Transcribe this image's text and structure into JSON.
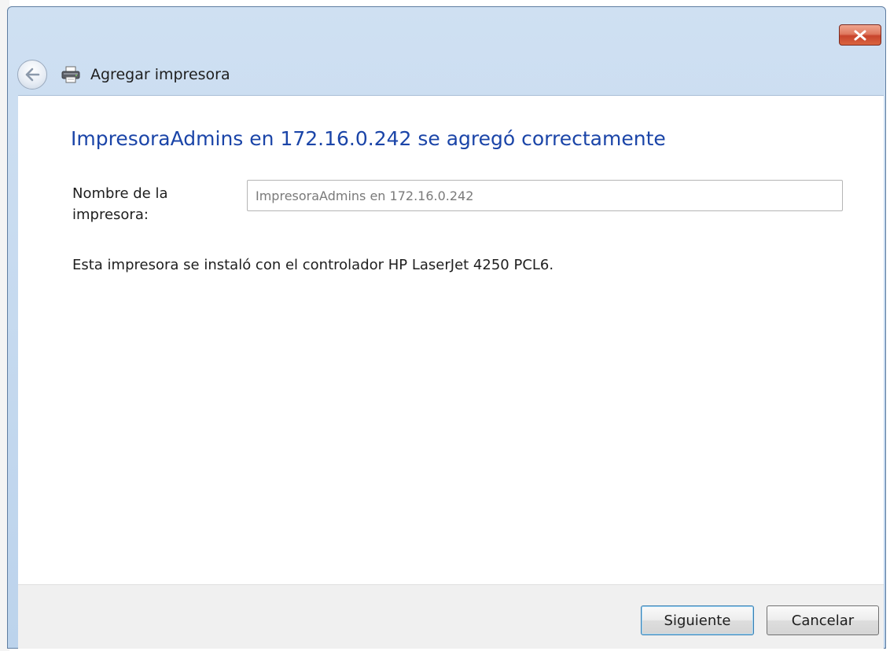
{
  "window": {
    "title": "Agregar impresora"
  },
  "content": {
    "heading": "ImpresoraAdmins en 172.16.0.242 se agregó correctamente",
    "printer_name_label_line1": "Nombre de la",
    "printer_name_label_line2": "impresora:",
    "printer_name_value": "ImpresoraAdmins en 172.16.0.242",
    "driver_message": "Esta impresora se instaló con el controlador HP LaserJet 4250 PCL6."
  },
  "footer": {
    "next_label": "Siguiente",
    "cancel_label": "Cancelar"
  },
  "icons": {
    "back": "back-arrow-icon",
    "printer": "printer-icon",
    "close": "close-icon"
  },
  "colors": {
    "heading": "#1b45a8",
    "titlebar": "#cfe0f2",
    "close_button": "#c8442c",
    "footer": "#f0f0f0"
  }
}
